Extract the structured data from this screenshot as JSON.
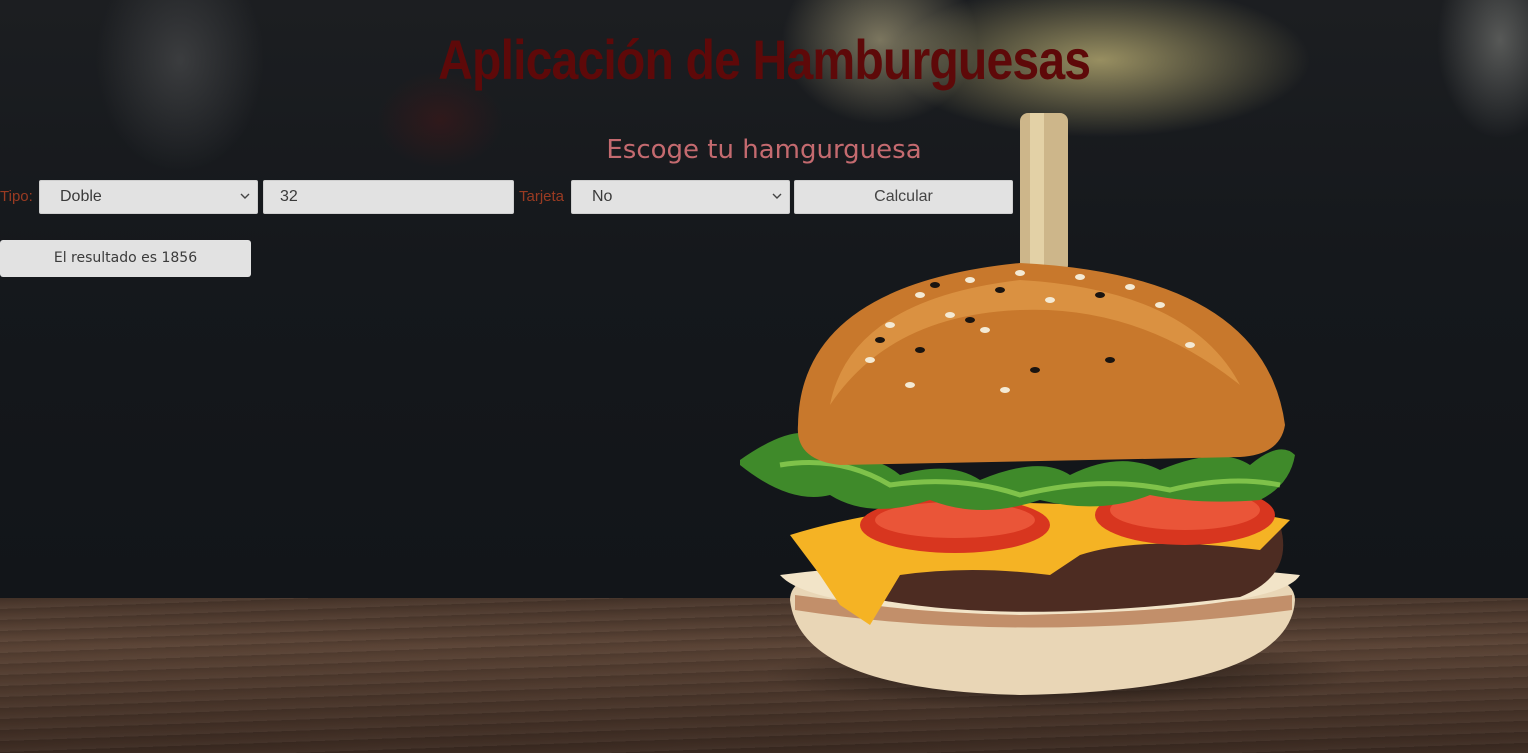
{
  "app": {
    "title": "Aplicación de Hamburguesas",
    "subtitle": "Escoge tu hamgurguesa"
  },
  "form": {
    "tipo_label": "Tipo:",
    "tipo_value": "Doble",
    "cantidad_value": "32",
    "tarjeta_label": "Tarjeta",
    "tarjeta_value": "No",
    "calcular_label": "Calcular"
  },
  "result": {
    "text": "El resultado es 1856"
  },
  "colors": {
    "title": "#5e0909",
    "subtitle": "#c46a6f",
    "labels": "#9a3b22",
    "controls_bg": "#e2e2e2"
  },
  "background": {
    "image": "burger-photo"
  }
}
